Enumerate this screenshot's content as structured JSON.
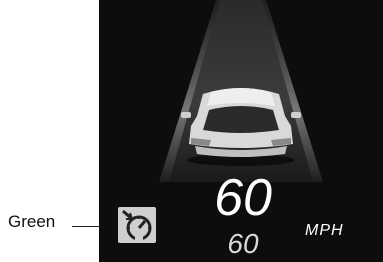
{
  "callout": {
    "label": "Green"
  },
  "display": {
    "speed": "60",
    "set_speed": "60",
    "unit": "MPH",
    "cruise_icon": "cruise-control-speedometer-icon",
    "cruise_icon_state_color": "#00a651"
  }
}
